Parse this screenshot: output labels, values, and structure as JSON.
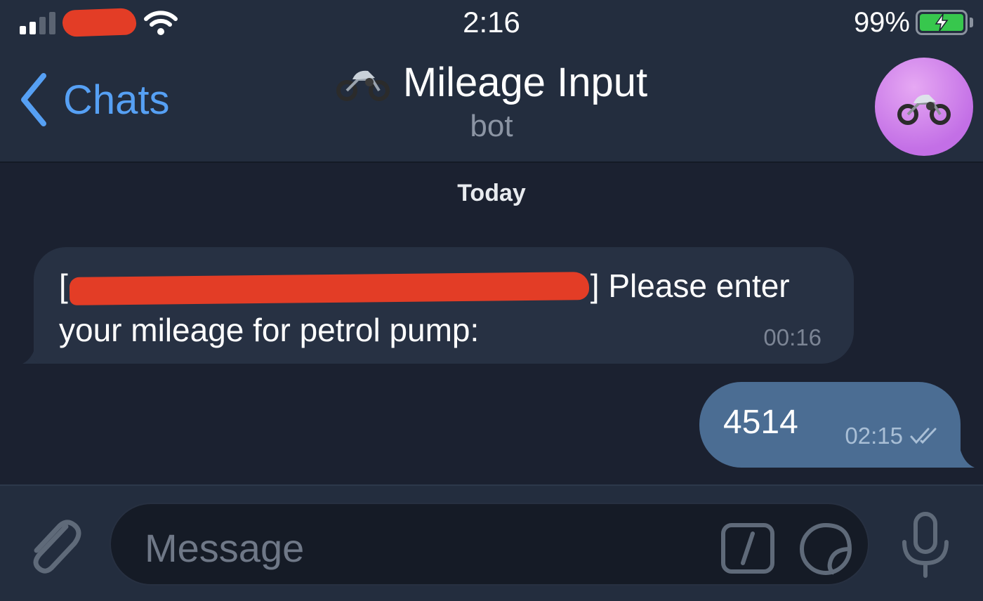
{
  "status_bar": {
    "time": "2:16",
    "battery_percent": "99%",
    "signal_bars": 2,
    "charging": true
  },
  "header": {
    "back_label": "Chats",
    "title": "Mileage Input",
    "subtitle": "bot",
    "title_emoji": "🏍️"
  },
  "chat": {
    "date_label": "Today",
    "messages": [
      {
        "direction": "incoming",
        "text_prefix": "[",
        "text_suffix": "] Please enter",
        "text_line2": "your mileage for petrol pump:",
        "time": "00:16"
      },
      {
        "direction": "outgoing",
        "text": "4514",
        "time": "02:15",
        "status": "read"
      }
    ]
  },
  "composer": {
    "placeholder": "Message"
  },
  "colors": {
    "accent": "#56a0f4",
    "outgoing_bubble": "#4b6d93",
    "incoming_bubble": "#273143",
    "header_bg": "#232d3e",
    "chat_bg": "#1b2130",
    "redaction": "#e33d26"
  }
}
